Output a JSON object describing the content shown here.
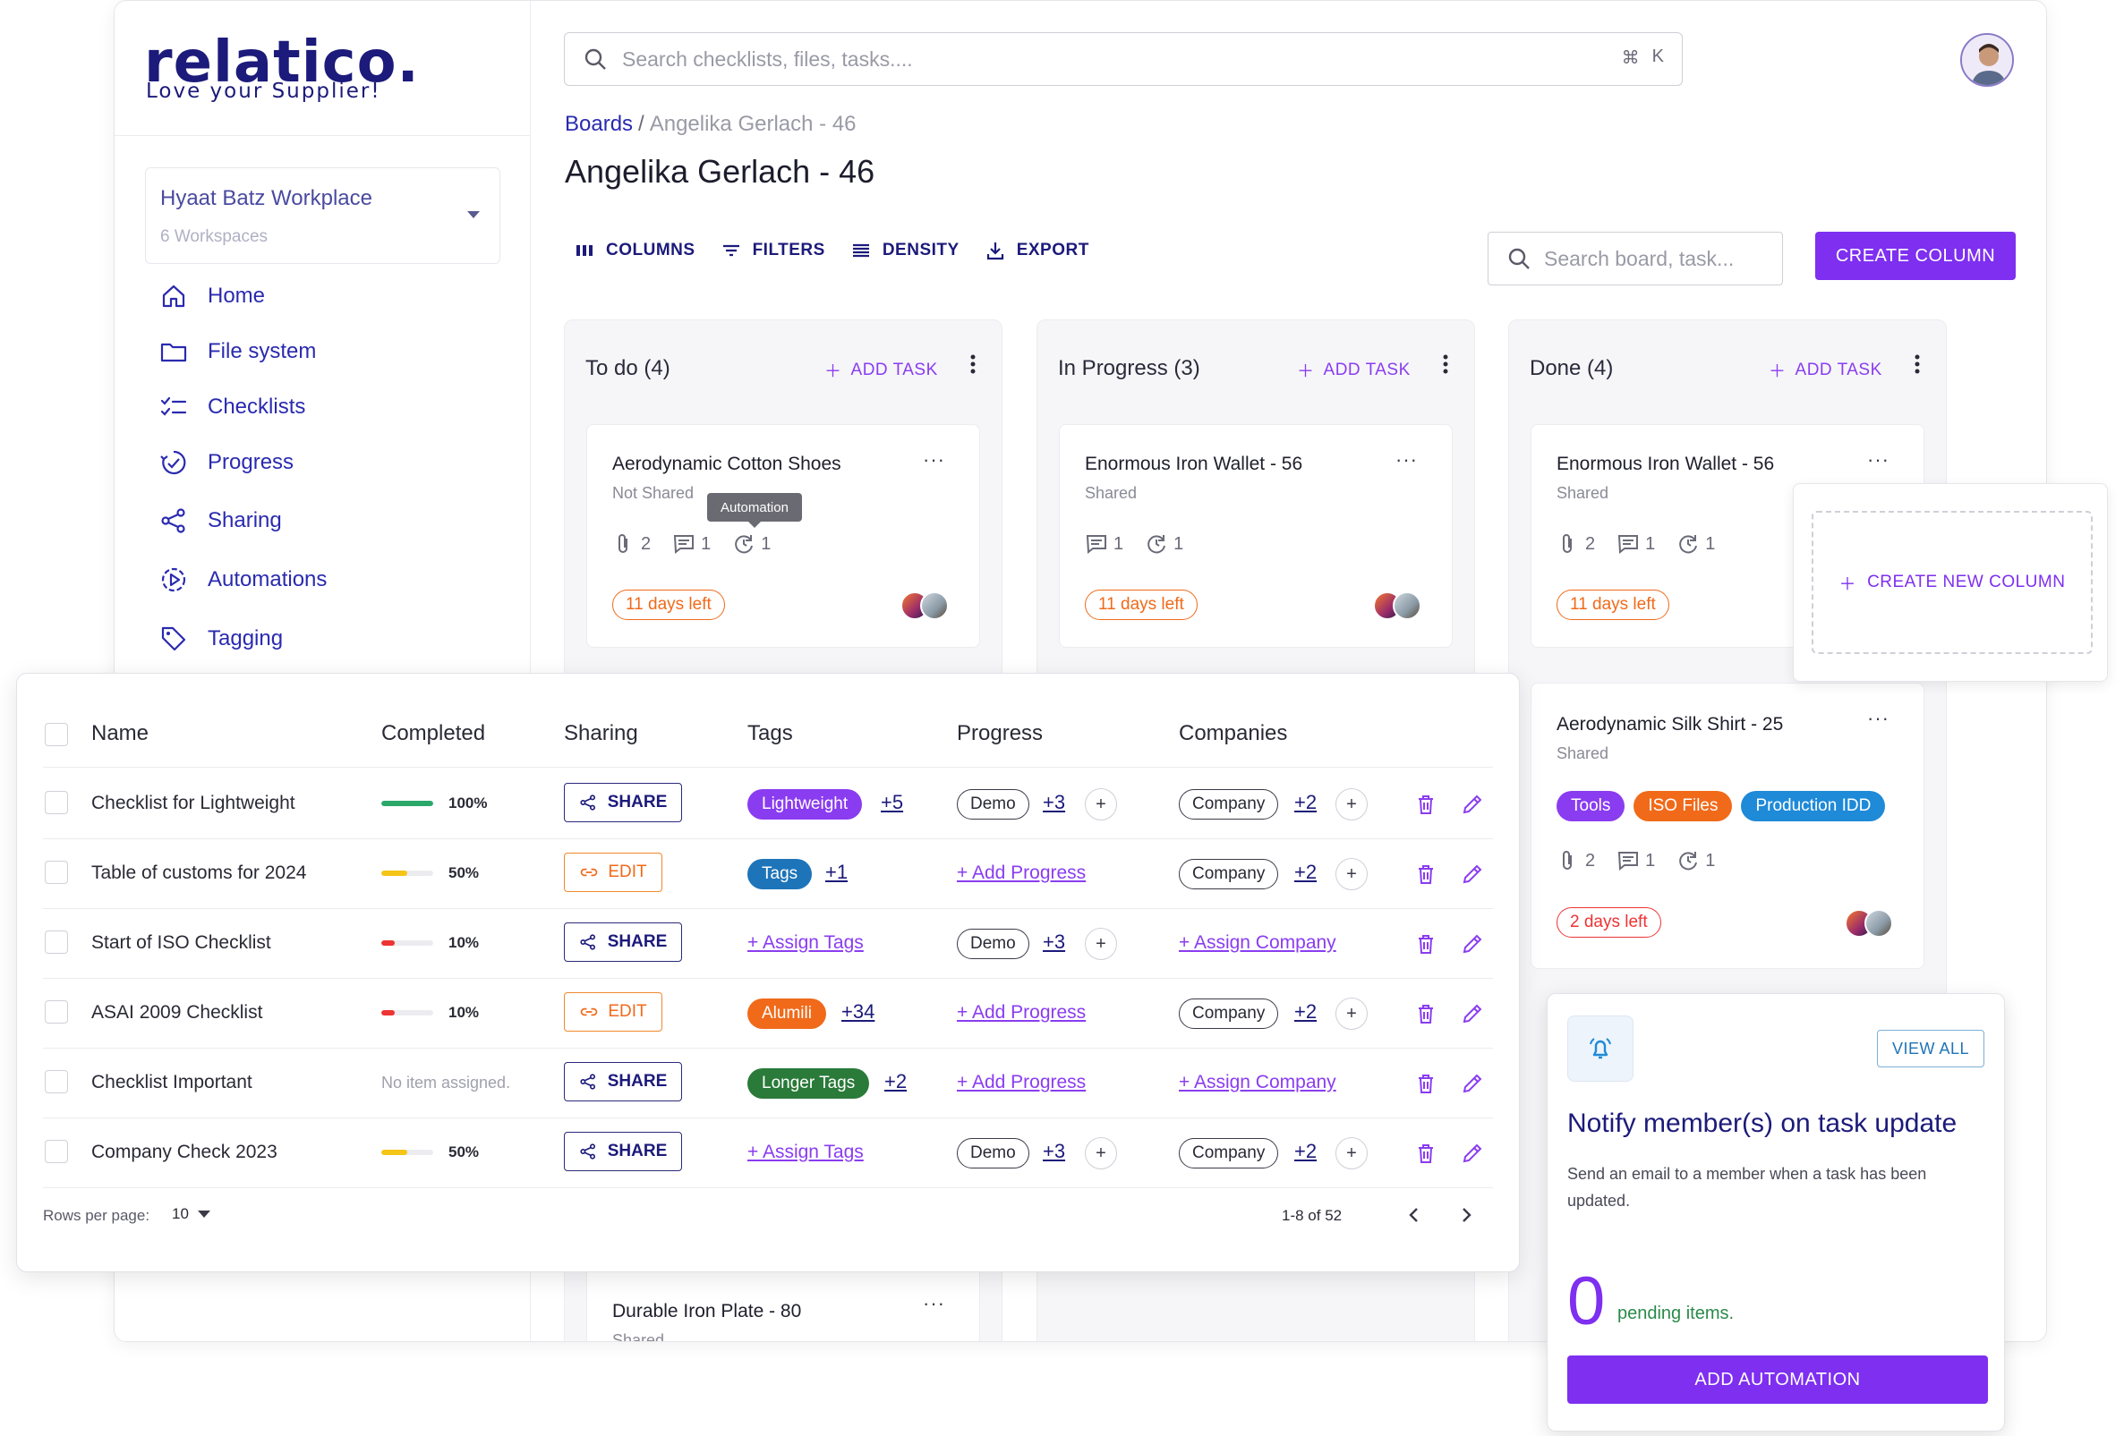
{
  "brand": {
    "name": "relatico.",
    "tagline": "Love your Supplier!"
  },
  "workspace": {
    "name": "Hyaat Batz Workplace",
    "count": "6 Workspaces"
  },
  "nav": [
    {
      "label": "Home",
      "icon": "home-icon"
    },
    {
      "label": "File system",
      "icon": "folder-icon"
    },
    {
      "label": "Checklists",
      "icon": "checklist-icon"
    },
    {
      "label": "Progress",
      "icon": "progress-icon"
    },
    {
      "label": "Sharing",
      "icon": "share-icon"
    },
    {
      "label": "Automations",
      "icon": "automation-icon"
    },
    {
      "label": "Tagging",
      "icon": "tag-icon"
    }
  ],
  "search": {
    "placeholder": "Search checklists, files, tasks....",
    "shortcut_cmd": "⌘",
    "shortcut_key": "K"
  },
  "breadcrumb": {
    "root": "Boards",
    "separator": "/",
    "current": "Angelika Gerlach - 46"
  },
  "page_title": "Angelika Gerlach - 46",
  "toolbar": {
    "columns": "COLUMNS",
    "filters": "FILTERS",
    "density": "DENSITY",
    "export": "EXPORT"
  },
  "board_search": {
    "placeholder": "Search board, task..."
  },
  "create_column": "CREATE COLUMN",
  "add_task": "ADD TASK",
  "columns": [
    {
      "title": "To do (4)"
    },
    {
      "title": "In Progress (3)"
    },
    {
      "title": "Done (4)"
    }
  ],
  "cards": {
    "todo1": {
      "title": "Aerodynamic Cotton Shoes",
      "status": "Not Shared",
      "attachments": "2",
      "comments": "1",
      "automations": "1",
      "due": "11 days left"
    },
    "todo_last": {
      "title": "Durable Iron Plate - 80",
      "status": "Shared"
    },
    "prog1": {
      "title": "Enormous Iron Wallet - 56",
      "status": "Shared",
      "comments": "1",
      "automations": "1",
      "due": "11 days left"
    },
    "done1": {
      "title": "Enormous Iron Wallet - 56",
      "status": "Shared",
      "attachments": "2",
      "comments": "1",
      "automations": "1",
      "due": "11 days left"
    },
    "done2": {
      "title": "Aerodynamic Silk Shirt - 25",
      "status": "Shared",
      "attachments": "2",
      "comments": "1",
      "automations": "1",
      "due": "2 days left",
      "tags": [
        {
          "label": "Tools",
          "color": "#8a3cf0"
        },
        {
          "label": "ISO Files",
          "color": "#f06a1a"
        },
        {
          "label": "Production IDD",
          "color": "#1e8ad8"
        }
      ]
    }
  },
  "tooltip": "Automation",
  "create_new_column": "CREATE NEW COLUMN",
  "table": {
    "headers": [
      "Name",
      "Completed",
      "Sharing",
      "Tags",
      "Progress",
      "Companies"
    ],
    "rows": [
      {
        "name": "Checklist for Lightweight",
        "completed": "100%",
        "completed_value": 1.0,
        "bar_color": "#2aa86a",
        "sharing": "SHARE",
        "tag": "Lightweight",
        "tag_color": "#8a3cf0",
        "tag_more": "+5",
        "progress": "Demo",
        "progress_more": "+3",
        "company": "Company",
        "company_more": "+2"
      },
      {
        "name": "Table of customs for 2024",
        "completed": "50%",
        "completed_value": 0.5,
        "bar_color": "#f5c518",
        "sharing": "EDIT",
        "tag": "Tags",
        "tag_color": "#1e74b8",
        "tag_more": "+1",
        "progress_link": "+ Add Progress",
        "company": "Company",
        "company_more": "+2"
      },
      {
        "name": "Start of ISO Checklist",
        "completed": "10%",
        "completed_value": 0.1,
        "bar_color": "#e33",
        "sharing": "SHARE",
        "tag_link": "+ Assign Tags",
        "progress": "Demo",
        "progress_more": "+3",
        "company_link": "+ Assign Company"
      },
      {
        "name": "ASAI 2009 Checklist",
        "completed": "10%",
        "completed_value": 0.1,
        "bar_color": "#e33",
        "sharing": "EDIT",
        "tag": "Alumili",
        "tag_color": "#f06a1a",
        "tag_more": "+34",
        "progress_link": "+ Add Progress",
        "company": "Company",
        "company_more": "+2"
      },
      {
        "name": "Checklist Important",
        "completed_none": "No item assigned.",
        "sharing": "SHARE",
        "tag": "Longer Tags",
        "tag_color": "#2a7a3a",
        "tag_more": "+2",
        "progress_link": "+ Add Progress",
        "company_link": "+ Assign Company"
      },
      {
        "name": "Company Check 2023",
        "completed": "50%",
        "completed_value": 0.5,
        "bar_color": "#f5c518",
        "sharing": "SHARE",
        "tag_link": "+ Assign Tags",
        "progress": "Demo",
        "progress_more": "+3",
        "company": "Company",
        "company_more": "+2"
      }
    ],
    "rows_per_page_label": "Rows per page:",
    "rows_per_page": "10",
    "pagination": "1-8 of 52"
  },
  "automation": {
    "view_all": "VIEW ALL",
    "title": "Notify member(s) on task update",
    "description": "Send an email to a member when a task has been updated.",
    "count": "0",
    "pending": "pending items.",
    "button": "ADD AUTOMATION"
  },
  "colors": {
    "primary": "#7e2ff0",
    "brand": "#1c1a7a",
    "link": "#2a2ab0"
  }
}
